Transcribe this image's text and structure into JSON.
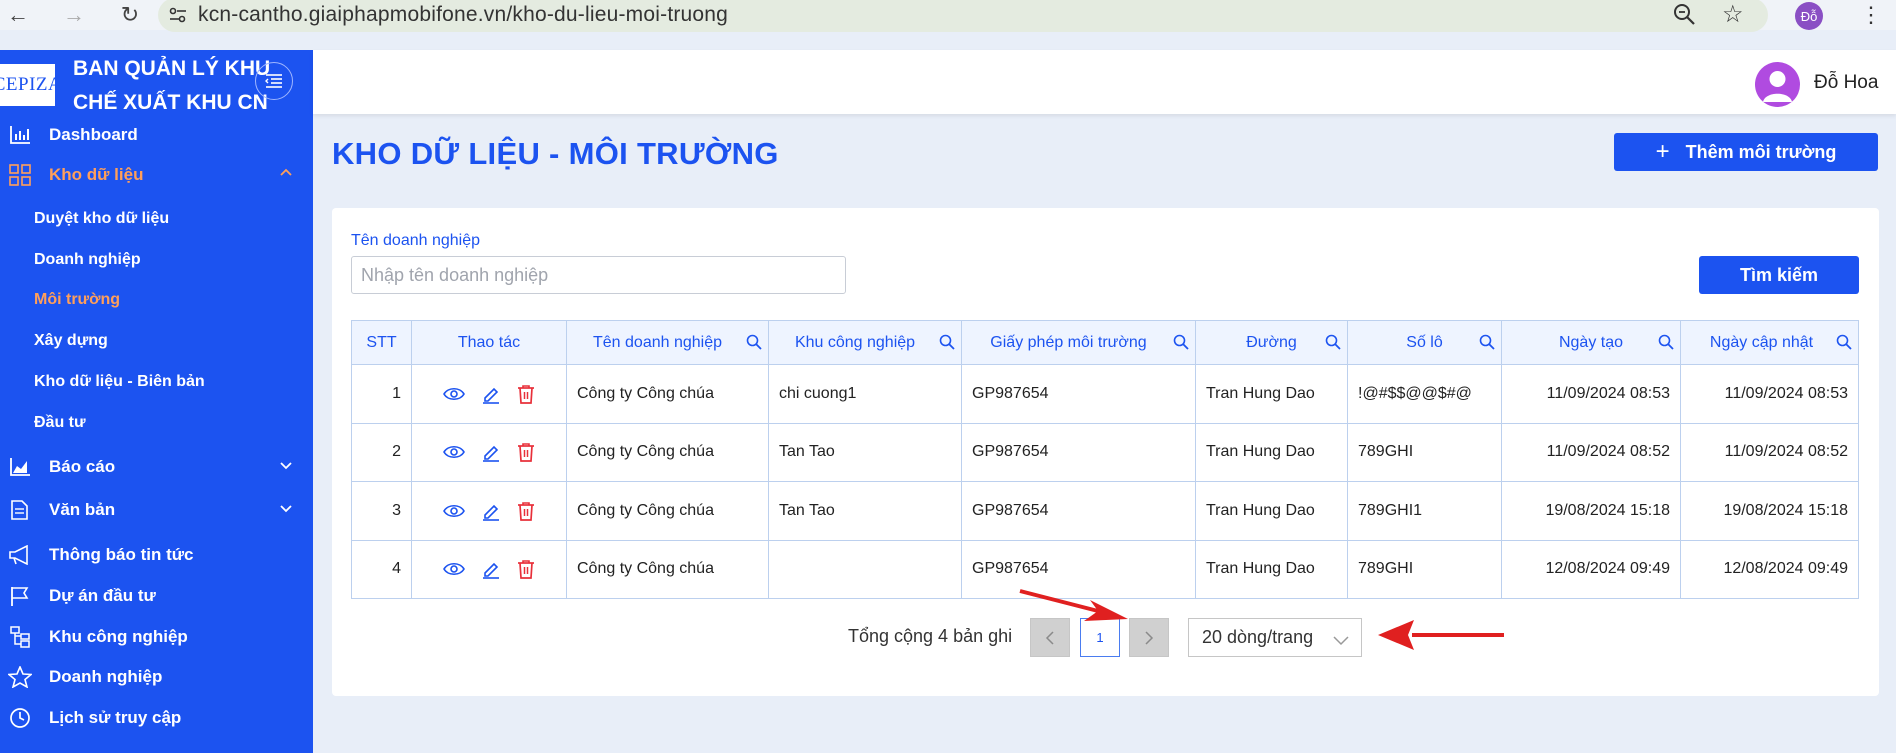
{
  "browser": {
    "url": "kcn-cantho.giaiphapmobifone.vn/kho-du-lieu-moi-truong",
    "profile_initial": "Đỗ"
  },
  "sidebar": {
    "logo_text": "CEPIZA",
    "org_title": "BAN QUẢN LÝ KHU CHẾ XUẤT KHU CN",
    "items": [
      {
        "label": "Dashboard",
        "icon": "bar-chart-icon"
      },
      {
        "label": "Kho dữ liệu",
        "icon": "grid-icon",
        "active": true
      },
      {
        "label": "Báo cáo",
        "icon": "area-chart-icon"
      },
      {
        "label": "Văn bản",
        "icon": "document-icon"
      },
      {
        "label": "Thông báo tin tức",
        "icon": "megaphone-icon"
      },
      {
        "label": "Dự án đầu tư",
        "icon": "flag-icon"
      },
      {
        "label": "Khu công nghiệp",
        "icon": "org-chart-icon"
      },
      {
        "label": "Doanh nghiệp",
        "icon": "star-icon"
      },
      {
        "label": "Lịch sử truy cập",
        "icon": "clock-icon"
      }
    ],
    "sub_items": [
      {
        "label": "Duyệt kho dữ liệu"
      },
      {
        "label": "Doanh nghiệp"
      },
      {
        "label": "Môi trường",
        "active": true
      },
      {
        "label": "Xây dựng"
      },
      {
        "label": "Kho dữ liệu - Biên bản"
      },
      {
        "label": "Đầu tư"
      }
    ]
  },
  "header": {
    "user_name": "Đỗ Hoa"
  },
  "page": {
    "title": "KHO DỮ LIỆU - MÔI TRƯỜNG",
    "add_button": "Thêm môi trường"
  },
  "filter": {
    "label": "Tên doanh nghiệp",
    "placeholder": "Nhập tên doanh nghiệp",
    "search_button": "Tìm kiếm"
  },
  "table": {
    "columns": [
      "STT",
      "Thao tác",
      "Tên doanh nghiệp",
      "Khu công nghiệp",
      "Giấy phép môi trường",
      "Đường",
      "Số lô",
      "Ngày tạo",
      "Ngày cập nhật"
    ],
    "rows": [
      {
        "stt": "1",
        "company": "Công ty Công chúa",
        "zone": "chi cuong1",
        "permit": "GP987654",
        "street": "Tran Hung Dao",
        "lot": "!@#$$@@$#@",
        "created": "11/09/2024 08:53",
        "updated": "11/09/2024 08:53"
      },
      {
        "stt": "2",
        "company": "Công ty Công chúa",
        "zone": "Tan Tao",
        "permit": "GP987654",
        "street": "Tran Hung Dao",
        "lot": "789GHI",
        "created": "11/09/2024 08:52",
        "updated": "11/09/2024 08:52"
      },
      {
        "stt": "3",
        "company": "Công ty Công chúa",
        "zone": "Tan Tao",
        "permit": "GP987654",
        "street": "Tran Hung Dao",
        "lot": "789GHI1",
        "created": "19/08/2024 15:18",
        "updated": "19/08/2024 15:18"
      },
      {
        "stt": "4",
        "company": "Công ty Công chúa",
        "zone": "",
        "permit": "GP987654",
        "street": "Tran Hung Dao",
        "lot": "789GHI",
        "created": "12/08/2024 09:49",
        "updated": "12/08/2024 09:49"
      }
    ]
  },
  "pagination": {
    "total_text": "Tổng cộng 4 bản ghi",
    "current_page": "1",
    "page_size": "20 dòng/trang"
  },
  "colors": {
    "primary": "#1c53f0",
    "active_menu": "#ff9f5a",
    "delete": "#e8303a",
    "annotation_arrow": "#e02020"
  }
}
